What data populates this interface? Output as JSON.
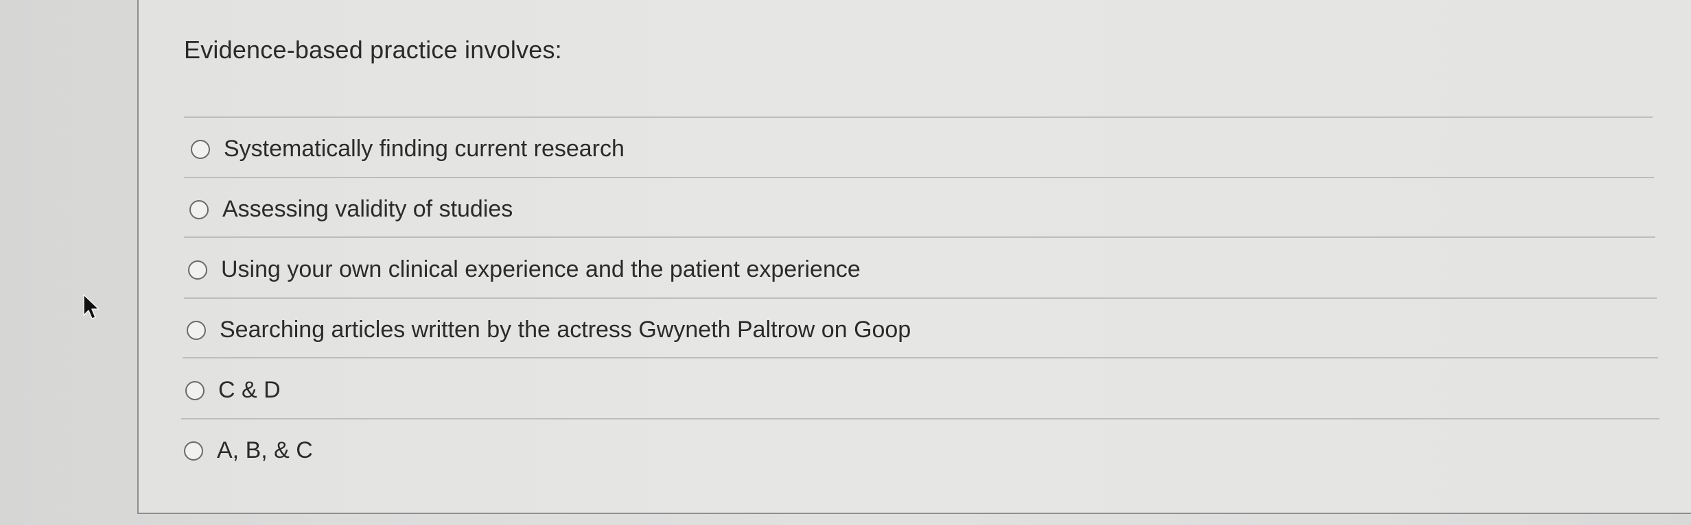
{
  "question": {
    "text": "Evidence-based practice involves:"
  },
  "options": [
    {
      "label": "Systematically finding current research"
    },
    {
      "label": "Assessing validity of studies"
    },
    {
      "label": "Using your own clinical experience and the patient experience"
    },
    {
      "label": "Searching articles written by the actress Gwyneth Paltrow on Goop"
    },
    {
      "label": "C & D"
    },
    {
      "label": "A, B, & C"
    }
  ],
  "icons": {
    "cursor": "arrow-pointer-icon",
    "option_control": "radio-button-unselected"
  },
  "colors": {
    "text": "#2b2b2b",
    "divider": "#bdbdbb",
    "radio_border": "#6a6a6a",
    "panel_border": "#8e8e8e"
  }
}
